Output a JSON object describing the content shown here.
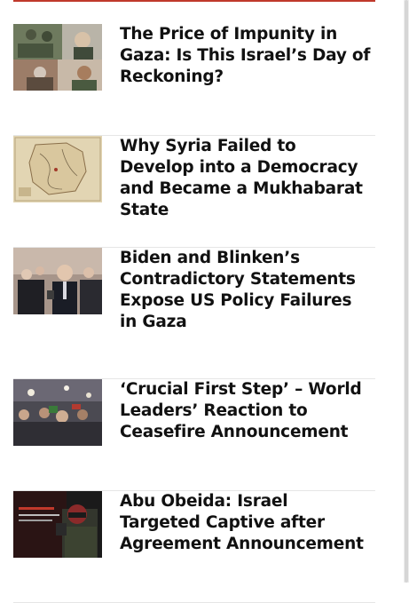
{
  "accent_color": "#c0392b",
  "articles": [
    {
      "title": "The Price of Impunity in Gaza: Is This Israel’s Day of Reckoning?",
      "image": "soldiers-collage-thumbnail"
    },
    {
      "title": "Why Syria Failed to Develop into a Democracy and Became a Mukhabarat State",
      "image": "old-map-thumbnail"
    },
    {
      "title": "Biden and Blinken’s Contradictory Statements Expose US Policy Failures in Gaza",
      "image": "press-crowd-thumbnail"
    },
    {
      "title": "‘Crucial First Step’ – World Leaders’ Reaction to Ceasefire Announcement",
      "image": "celebration-crowd-thumbnail"
    },
    {
      "title": "Abu Obeida: Israel Targeted Captive after Agreement Announcement",
      "image": "masked-spokesman-thumbnail"
    }
  ]
}
